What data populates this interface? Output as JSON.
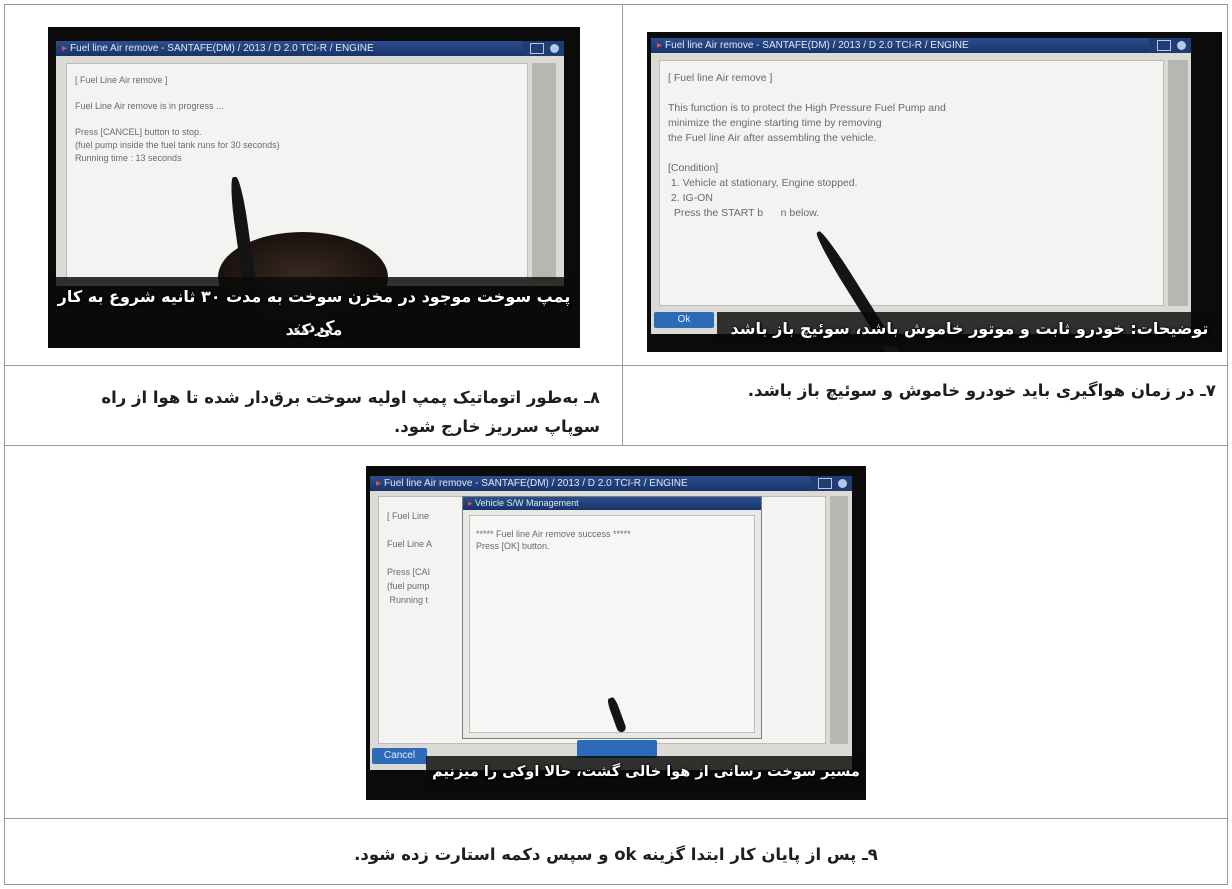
{
  "panels": {
    "step7": {
      "screen_title": "Fuel line Air remove - SANTAFE(DM) / 2013 / D 2.0 TCI-R / ENGINE",
      "lines": [
        "[ Fuel line Air remove ]",
        "",
        "This function is to protect the High Pressure Fuel Pump and",
        "minimize the engine starting time by removing",
        "the Fuel line Air after assembling the vehicle.",
        "",
        "[Condition]",
        " 1. Vehicle at stationary, Engine stopped.",
        " 2. IG-ON",
        "  Press the START b      n below."
      ],
      "button_label": "Ok",
      "subtitle": "توضیحات: خودرو ثابت و موتور خاموش باشد، سوئیچ باز باشد",
      "caption": "۷ـ در زمان هواگیری باید خودرو خاموش و سوئیچ  باز باشد."
    },
    "step8": {
      "screen_title": "Fuel line Air remove - SANTAFE(DM) / 2013 / D 2.0 TCI-R / ENGINE",
      "lines": [
        "[ Fuel Line Air remove ]",
        "",
        "Fuel Line Air remove is in progress ...",
        "",
        "Press [CANCEL] button to stop.",
        "(fuel pump inside the fuel tank runs for 30 seconds)",
        "Running time : 13 seconds"
      ],
      "subtitle_line1": "پمپ سوخت موجود در مخزن سوخت به مدت ۳۰ ثانیه شروع به کار کردن",
      "subtitle_line2": "می کند",
      "caption_line1": "۸ـ به‌طور اتوماتیک پمپ اولیه سوخت برق‌دار شده تا هوا از راه",
      "caption_line2": "سوپاپ سرریز خارج شود."
    },
    "step9": {
      "screen_title": "Fuel line Air remove - SANTAFE(DM) / 2013 / D 2.0 TCI-R / ENGINE",
      "bg_lines": [
        "[ Fuel Line",
        "",
        "Fuel Line A",
        "",
        "Press [CAI",
        "(fuel pump",
        " Running t"
      ],
      "dialog_title": "Vehicle S/W Management",
      "dialog_lines": [
        "***** Fuel line Air remove success *****",
        "Press [OK] button."
      ],
      "cancel_label": "Cancel",
      "subtitle": "مسیر سوخت رسانی از هوا خالی گشت، حالا اوکی را میزنیم",
      "caption": "۹ـ پس از پایان کار ابتدا گزینه ok و سپس دکمه استارت زده شود."
    }
  }
}
